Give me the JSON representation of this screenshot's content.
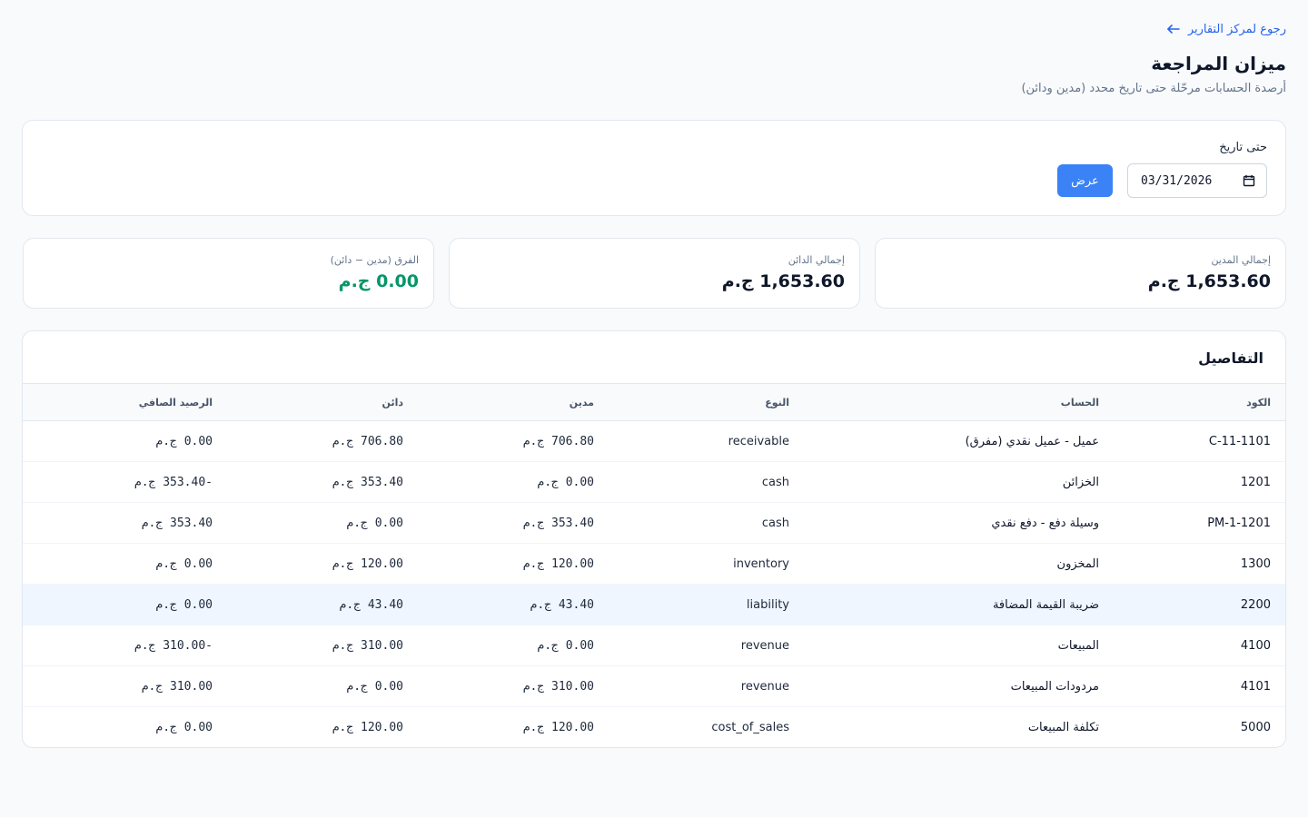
{
  "nav": {
    "back_label": "رجوع لمركز التقارير"
  },
  "header": {
    "title": "ميزان المراجعة",
    "subtitle": "أرصدة الحسابات مرحّلة حتى تاريخ محدد (مدين ودائن)"
  },
  "filter": {
    "date_label": "حتى تاريخ",
    "date_value": "03/31/2026",
    "submit_label": "عرض"
  },
  "summary": {
    "total_debit_label": "إجمالي المدين",
    "total_debit_value": "1,653.60 ج.م",
    "total_credit_label": "إجمالي الدائن",
    "total_credit_value": "1,653.60 ج.م",
    "difference_label": "الفرق (مدين − دائن)",
    "difference_value": "0.00 ج.م"
  },
  "details": {
    "title": "التفاصيل",
    "columns": {
      "code": "الكود",
      "account": "الحساب",
      "type": "النوع",
      "debit": "مدين",
      "credit": "دائن",
      "net": "الرصيد الصافي"
    },
    "rows": [
      {
        "code": "C-11-1101",
        "account": "عميل - عميل نقدي (مفرق)",
        "type": "receivable",
        "debit": "706.80 ج.م",
        "credit": "706.80 ج.م",
        "net": "0.00 ج.م"
      },
      {
        "code": "1201",
        "account": "الخزائن",
        "type": "cash",
        "debit": "0.00 ج.م",
        "credit": "353.40 ج.م",
        "net": "-353.40 ج.م"
      },
      {
        "code": "PM-1-1201",
        "account": "وسيلة دفع - دفع نقدي",
        "type": "cash",
        "debit": "353.40 ج.م",
        "credit": "0.00 ج.م",
        "net": "353.40 ج.م"
      },
      {
        "code": "1300",
        "account": "المخزون",
        "type": "inventory",
        "debit": "120.00 ج.م",
        "credit": "120.00 ج.م",
        "net": "0.00 ج.م"
      },
      {
        "code": "2200",
        "account": "ضريبة القيمة المضافة",
        "type": "liability",
        "debit": "43.40 ج.م",
        "credit": "43.40 ج.م",
        "net": "0.00 ج.م"
      },
      {
        "code": "4100",
        "account": "المبيعات",
        "type": "revenue",
        "debit": "0.00 ج.م",
        "credit": "310.00 ج.م",
        "net": "-310.00 ج.م"
      },
      {
        "code": "4101",
        "account": "مردودات المبيعات",
        "type": "revenue",
        "debit": "310.00 ج.م",
        "credit": "0.00 ج.م",
        "net": "310.00 ج.م"
      },
      {
        "code": "5000",
        "account": "تكلفة المبيعات",
        "type": "cost_of_sales",
        "debit": "120.00 ج.م",
        "credit": "120.00 ج.م",
        "net": "0.00 ج.م"
      }
    ]
  },
  "colors": {
    "accent": "#3b82f6",
    "link": "#2563eb",
    "positive": "#059669",
    "highlight_row": "#eff6ff"
  },
  "icons": {
    "back": "arrow-left-icon",
    "calendar": "calendar-icon"
  }
}
